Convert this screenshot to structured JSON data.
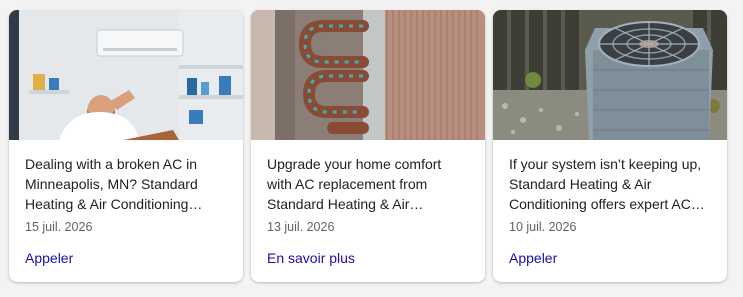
{
  "cards": [
    {
      "image": "man-fanning-himself-with-ac-unit",
      "description": "Dealing with a broken AC in Minneapolis, MN? Standard Heating & Air Conditioning…",
      "date": "15 juil. 2026",
      "cta": "Appeler"
    },
    {
      "image": "corroded-ac-coil-copper-pipes",
      "description": "Upgrade your home comfort with AC replacement from Standard Heating & Air…",
      "date": "13 juil. 2026",
      "cta": "En savoir plus"
    },
    {
      "image": "outdoor-ac-condenser-unit",
      "description": "If your system isn’t keeping up, Standard Heating & Air Conditioning offers expert AC…",
      "date": "10 juil. 2026",
      "cta": "Appeler"
    }
  ],
  "colors": {
    "link": "#1a0dab",
    "text": "#202124",
    "meta": "#5f6368",
    "card_bg": "#ffffff",
    "page_bg": "#f3f3f3"
  }
}
